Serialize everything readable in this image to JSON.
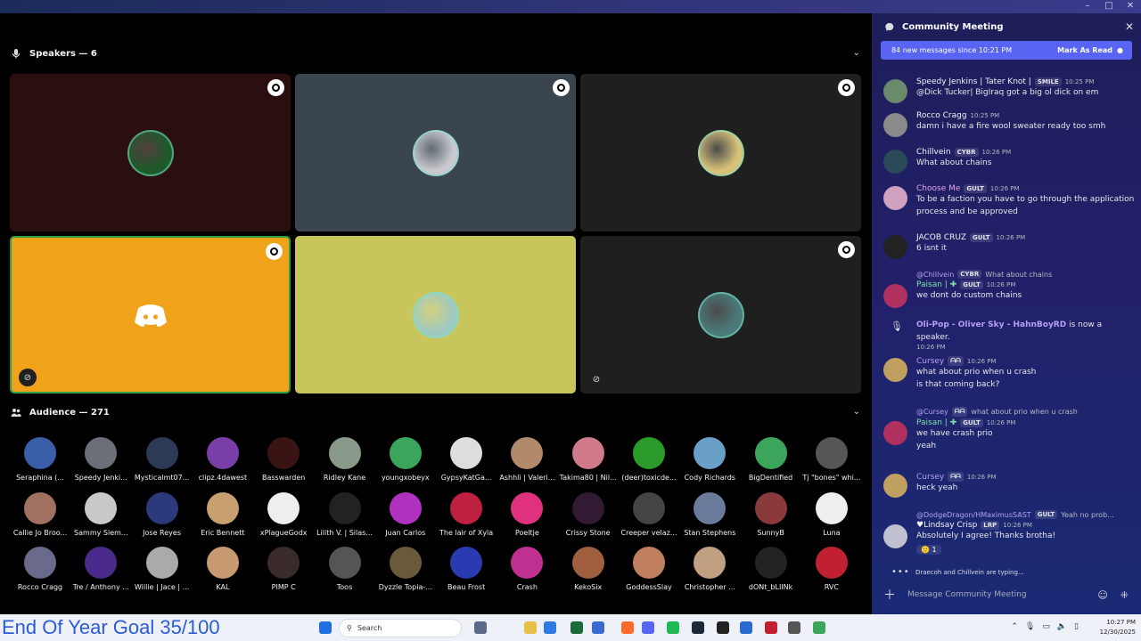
{
  "window": {
    "minimize": "–",
    "maximize": "□",
    "close": "✕"
  },
  "stage": {
    "speakers_heading": "Speakers — 6",
    "audience_heading": "Audience — 271"
  },
  "speakers": [
    {
      "bg": "#2b0e10",
      "avatar": "#1d5a2a"
    },
    {
      "bg": "#3b4550",
      "avatar": "#c9c9cf"
    },
    {
      "bg": "#1f1f1f",
      "avatar": "#d8c27a"
    },
    {
      "bg": "#f0a31a",
      "avatar": "discord"
    },
    {
      "bg": "#c9c55d",
      "avatar": "#9ec9c0"
    },
    {
      "bg": "#1f1f1f",
      "avatar": "#4a7a7a"
    }
  ],
  "audience": [
    [
      "Seraphina (...",
      "Speedy Jenki...",
      "Mysticalmt07...",
      "clipz.4dawest",
      "Basswarden",
      "Ridley Kane",
      "youngxobeyx",
      "GypsyKatGa...",
      "Ashhli | Valeri...",
      "Takima80 | Nil...",
      "(deer)toxicde...",
      "Cody Richards",
      "BigDentified",
      "Tj \"bones\" whi..."
    ],
    [
      "Callie Jo Broo...",
      "Sammy Siem...",
      "Jose Reyes",
      "Eric Bennett",
      "xPlagueGodx",
      "Lilith V. | Silas...",
      "Juan Carlos",
      "The lair of Xyla",
      "Poeltje",
      "Crissy Stone",
      "Creeper velaz...",
      "Stan Stephens",
      "SunnyB",
      "Luna"
    ],
    [
      "Rocco Cragg",
      "Tre / Anthony ...",
      "Willie | Jace | ...",
      "KAL",
      "PIMP C",
      "Toos",
      "Dyzzle Topia-...",
      "Beau Frost",
      "Crash",
      "KekoSix",
      "GoddessSlay",
      "Christopher ...",
      "dONt_bLIINk",
      "RVC"
    ]
  ],
  "chat": {
    "title": "Community Meeting",
    "new_messages": "84 new messages since 10:21 PM",
    "mark_read": "Mark As Read",
    "messages": [
      {
        "author": "Speedy Jenkins | Tater Knot |",
        "tag": "SMILE",
        "time": "10:25 PM",
        "text": "@Dick Tucker| BigIraq  got a big ol dick on em",
        "color": "#f2f3f5"
      },
      {
        "author": "Rocco Cragg",
        "tag": "",
        "time": "10:25 PM",
        "text": "damn i have a fire wool sweater ready too smh",
        "color": "#f2f3f5"
      },
      {
        "author": "Chillvein",
        "tag": "CYBR",
        "time": "10:26 PM",
        "text": "What about chains",
        "color": "#f2f3f5"
      },
      {
        "author": "Choose Me",
        "tag": "GULT",
        "time": "10:26 PM",
        "text": "To be a faction you have to go through the application process and be approved",
        "color": "#e6a3e6"
      },
      {
        "author": "JACOB CRUZ",
        "tag": "GULT",
        "time": "10:26 PM",
        "text": "6 isnt it",
        "color": "#f2f3f5"
      },
      {
        "reply": "@Chillvein",
        "reply_tag": "CYBR",
        "reply_text": "What about chains",
        "author": "Paisan | ✚",
        "tag": "GULT",
        "time": "10:26 PM",
        "text": "we dont do custom chains",
        "color": "#7ee2a8"
      },
      {
        "system_author": "Oli-Pop - Oliver Sky - HahnBoyRD",
        "system_text": "is now a speaker.",
        "time": "10:26 PM"
      },
      {
        "author": "Cursey",
        "tag": "ᗩᗩ",
        "time": "10:26 PM",
        "text": "what about prio when u crash",
        "text2": "is that coming back?",
        "color": "#b4a1f5"
      },
      {
        "reply": "@Cursey",
        "reply_tag": "ᗩᗩ",
        "reply_text": "what about prio when u crash",
        "author": "Paisan | ✚",
        "tag": "GULT",
        "time": "10:26 PM",
        "text": "we have crash prio",
        "text2": "yeah",
        "color": "#7ee2a8"
      },
      {
        "author": "Cursey",
        "tag": "ᗩᗩ",
        "time": "10:26 PM",
        "text": "heck yeah",
        "color": "#b4a1f5"
      },
      {
        "reply": "@DodgeDragon/HMaximusSAST",
        "reply_tag": "GULT",
        "reply_text": "Yeah no prob...",
        "author": "♥Lindsay Crisp",
        "tag": "LRP",
        "time": "10:26 PM",
        "text": "Absolutely I agree! Thanks brotha!",
        "color": "#f2f3f5",
        "reaction": "🙂 1"
      }
    ],
    "typing": "Draecoh and Chillvein are typing...",
    "placeholder": "Message Community Meeting"
  },
  "taskbar": {
    "goal_overlay": "End Of Year Goal 35/100",
    "search_label": "Search",
    "time": "10:27 PM",
    "date": "12/30/2025"
  }
}
